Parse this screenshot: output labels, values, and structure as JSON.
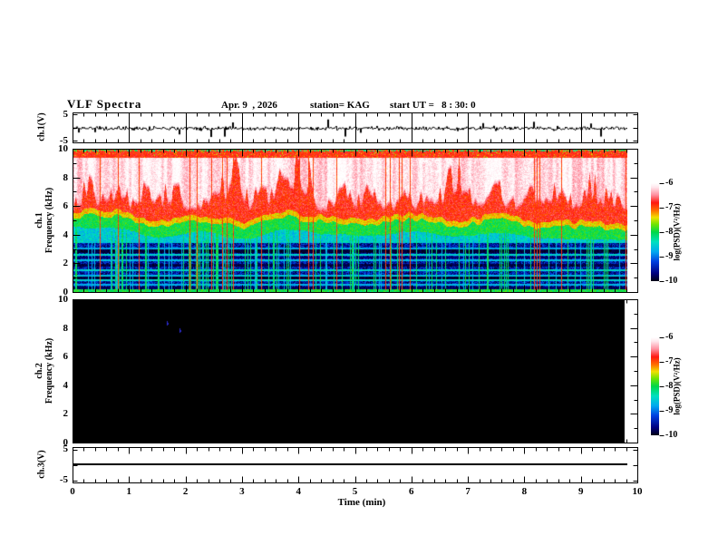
{
  "header": {
    "title": "VLF Spectra",
    "date": "Apr. 9  , 2026",
    "station": "station= KAG",
    "start_ut": "start UT =   8 : 30: 0"
  },
  "panels": {
    "ch1_wave": {
      "label": "ch.1(V)",
      "ytick_top": "5",
      "ytick_bottom": "-5"
    },
    "spec1": {
      "label_line1": "ch.1",
      "label_line2": "Frequency (kHz)",
      "yticks": [
        "10",
        "8",
        "6",
        "4",
        "2",
        "0"
      ]
    },
    "spec2": {
      "label_line1": "ch.2",
      "label_line2": "Frequency (kHz)",
      "yticks": [
        "10",
        "8",
        "6",
        "4",
        "2",
        "0"
      ]
    },
    "ch3_wave": {
      "label": "ch.3(V)",
      "ytick_top": "5",
      "ytick_bottom": "-5"
    }
  },
  "xaxis": {
    "label": "Time (min)",
    "ticks": [
      "0",
      "1",
      "2",
      "3",
      "4",
      "5",
      "6",
      "7",
      "8",
      "9",
      "10"
    ]
  },
  "colorbar": {
    "label": "log(PSD)(V²/Hz)",
    "ticks": [
      "-6",
      "-7",
      "-8",
      "-9",
      "-10"
    ]
  },
  "chart_data": {
    "type": "heatmap",
    "title": "VLF Spectra  Apr. 9, 2026  station KAG  start UT 8:30:0",
    "x": {
      "label": "Time (min)",
      "range": [
        0,
        10
      ],
      "major_tick": 1,
      "minor_tick": 0.2,
      "data_end_min": 9.8
    },
    "z": {
      "label": "log(PSD)(V²/Hz)",
      "range": [
        -10,
        -6
      ]
    },
    "colormap": [
      [
        0.0,
        "#000014"
      ],
      [
        0.08,
        "#000080"
      ],
      [
        0.2,
        "#0040e0"
      ],
      [
        0.3,
        "#00a8f0"
      ],
      [
        0.4,
        "#00e0c0"
      ],
      [
        0.5,
        "#00d848"
      ],
      [
        0.58,
        "#70e400"
      ],
      [
        0.65,
        "#f0e000"
      ],
      [
        0.72,
        "#ff7000"
      ],
      [
        0.8,
        "#ff1810"
      ],
      [
        0.88,
        "#ff90a0"
      ],
      [
        0.96,
        "#ffe8ee"
      ],
      [
        1.0,
        "#ffffff"
      ]
    ],
    "panels": [
      {
        "id": "ch1_waveform",
        "type": "line",
        "ylabel": "ch.1(V)",
        "yrange": [
          -5,
          5
        ],
        "summary": "broadband noise around 0 V (~±1 V) with sporadic impulses up to ~±3.5 V, data from 0 to 9.8 min"
      },
      {
        "id": "ch1_spectrogram",
        "type": "heatmap",
        "ylabel": "Frequency (kHz)",
        "yrange_khz": [
          0,
          10
        ],
        "summary": "intense VLF hiss: near-white PSD (~-6) in vertical bursts between ~5.5 and 9.5 kHz, red (~-7) fringes, yellow-green transition at 4-5.5 kHz, cyan 3.5-4.5 kHz, dark blue/black below 3.5 kHz crossed by horizontal cyan lines and dense vertical sferic streaks; green line at 0 kHz, red jagged line at ~9.6 kHz",
        "model": {
          "top_speckle_above_khz": 9.85,
          "top_red_band_khz": [
            9.42,
            9.85
          ],
          "white_level": -6.13,
          "white_depth_base": 5.45,
          "white_depth_gain": 4.3,
          "red_level": -6.82,
          "red_bottom_base": 4.5,
          "red_bottom_gain": 1.05,
          "yellow_band_khz": 0.38,
          "yellow_level": -7.35,
          "green_level": -7.98,
          "cyan_to_khz": 3.42,
          "cyan_level": -8.55,
          "low_level": -9.4,
          "black_below_khz": 0.38,
          "bottom_edge_khz": 0.14,
          "bottom_edge_level": -8.0,
          "stripes_bright": [
            [
              3.82,
              -8.5,
              0.07
            ],
            [
              3.45,
              -8.72,
              0.06
            ],
            [
              3.02,
              -8.78,
              0.06
            ],
            [
              2.58,
              -8.5,
              0.07
            ],
            [
              2.18,
              -8.68,
              0.06
            ],
            [
              1.52,
              -8.48,
              0.07
            ],
            [
              1.12,
              -8.68,
              0.06
            ],
            [
              0.78,
              -8.52,
              0.06
            ],
            [
              0.48,
              -8.72,
              0.05
            ]
          ],
          "stripes_dark": [
            [
              2.84,
              -9.9,
              0.14
            ],
            [
              2.38,
              -9.75,
              0.07
            ],
            [
              1.84,
              -9.85,
              0.12
            ],
            [
              0.95,
              -9.9,
              0.1
            ]
          ],
          "sferic_density": {
            "red": 0.032,
            "cyan": 0.043,
            "green": 0.1
          }
        }
      },
      {
        "id": "ch2_spectrogram",
        "type": "heatmap",
        "ylabel": "Frequency (kHz)",
        "yrange_khz": [
          0,
          10
        ],
        "summary": "no signal: uniform black (PSD below -10) from 0 to ~9.8 min",
        "artifacts": [
          {
            "t_min": 1.67,
            "f_khz": 8.5
          },
          {
            "t_min": 1.9,
            "f_khz": 8.0
          }
        ]
      },
      {
        "id": "ch3_waveform",
        "type": "line",
        "ylabel": "ch.3(V)",
        "yrange": [
          -5,
          5
        ],
        "summary": "constant 0 V line from 0 to 9.8 min"
      }
    ]
  }
}
